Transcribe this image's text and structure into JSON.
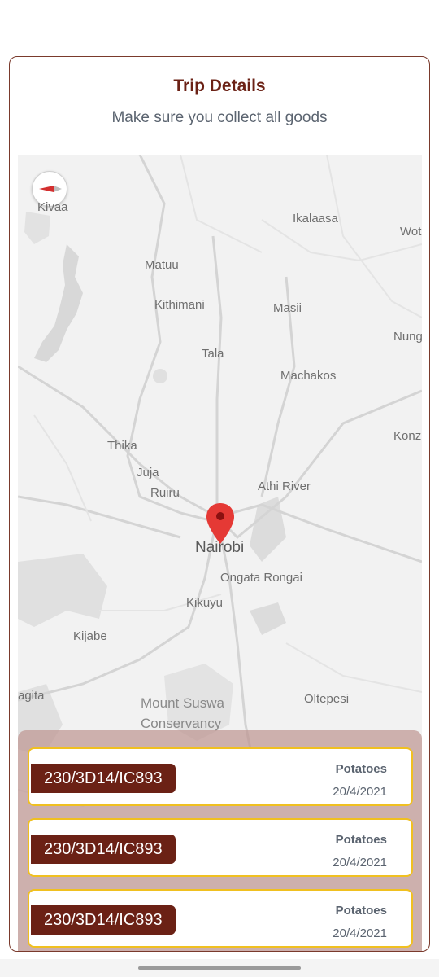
{
  "header": {
    "title": "Trip Details",
    "subtitle": "Make sure you collect all goods"
  },
  "map": {
    "places": [
      {
        "key": "kivaa",
        "label": "Kivaa"
      },
      {
        "key": "ikalaasa",
        "label": "Ikalaasa"
      },
      {
        "key": "wot",
        "label": "Wot"
      },
      {
        "key": "matuu",
        "label": "Matuu"
      },
      {
        "key": "kithimani",
        "label": "Kithimani"
      },
      {
        "key": "masii",
        "label": "Masii"
      },
      {
        "key": "nung",
        "label": "Nung"
      },
      {
        "key": "tala",
        "label": "Tala"
      },
      {
        "key": "machakos",
        "label": "Machakos"
      },
      {
        "key": "konza",
        "label": "Konz"
      },
      {
        "key": "thika",
        "label": "Thika"
      },
      {
        "key": "juja",
        "label": "Juja"
      },
      {
        "key": "ruiru",
        "label": "Ruiru"
      },
      {
        "key": "athi",
        "label": "Athi River"
      },
      {
        "key": "nairobi",
        "label": "Nairobi"
      },
      {
        "key": "ongata",
        "label": "Ongata Rongai"
      },
      {
        "key": "kikuyu",
        "label": "Kikuyu"
      },
      {
        "key": "kijabe",
        "label": "Kijabe"
      },
      {
        "key": "agita",
        "label": "agita"
      },
      {
        "key": "suswa",
        "label": "Mount Suswa"
      },
      {
        "key": "conservancy",
        "label": "Conservancy"
      },
      {
        "key": "oltepesi",
        "label": "Oltepesi"
      }
    ]
  },
  "trips": [
    {
      "id": "230/3D14/IC893",
      "product": "Potatoes",
      "date": "20/4/2021"
    },
    {
      "id": "230/3D14/IC893",
      "product": "Potatoes",
      "date": "20/4/2021"
    },
    {
      "id": "230/3D14/IC893",
      "product": "Potatoes",
      "date": "20/4/2021"
    }
  ],
  "colors": {
    "brand": "#6b2115",
    "card_border": "#f0c020",
    "pin": "#e53935"
  }
}
